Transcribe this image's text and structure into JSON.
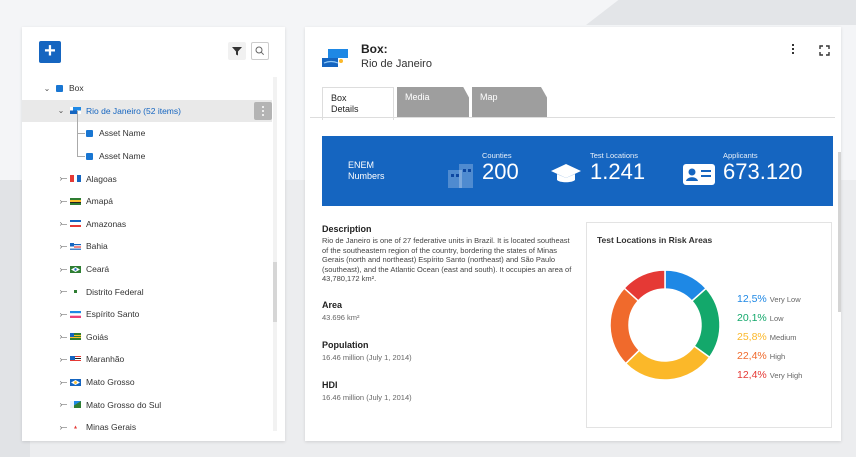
{
  "colors": {
    "accent": "#1565c0",
    "very_low": "#1e88e5",
    "low": "#13a86b",
    "medium": "#fbb829",
    "high": "#f06a2c",
    "very_high": "#e53935"
  },
  "left": {
    "add_label": "+",
    "tree": [
      {
        "label": "Box",
        "level": 0,
        "caret": "⌄",
        "icon": "box-square"
      },
      {
        "label": "Rio de Janeiro (52 items)",
        "level": 1,
        "caret": "⌄",
        "icon": "rio-flag",
        "selected": true
      },
      {
        "label": "Asset Name",
        "level": 2,
        "caret": "",
        "icon": "box-square"
      },
      {
        "label": "Asset Name",
        "level": 2,
        "caret": "",
        "icon": "box-square"
      },
      {
        "label": "Alagoas",
        "level": 1,
        "caret": "›",
        "icon": "alagoas-flag"
      },
      {
        "label": "Amapá",
        "level": 1,
        "caret": "›",
        "icon": "amapa-flag"
      },
      {
        "label": "Amazonas",
        "level": 1,
        "caret": "›",
        "icon": "amazonas-flag"
      },
      {
        "label": "Bahia",
        "level": 1,
        "caret": "›",
        "icon": "bahia-flag"
      },
      {
        "label": "Ceará",
        "level": 1,
        "caret": "›",
        "icon": "ceara-flag"
      },
      {
        "label": "Distrito Federal",
        "level": 1,
        "caret": "›",
        "icon": "df-flag"
      },
      {
        "label": "Espírito Santo",
        "level": 1,
        "caret": "›",
        "icon": "es-flag"
      },
      {
        "label": "Goiás",
        "level": 1,
        "caret": "›",
        "icon": "goias-flag"
      },
      {
        "label": "Maranhão",
        "level": 1,
        "caret": "›",
        "icon": "maranhao-flag"
      },
      {
        "label": "Mato Grosso",
        "level": 1,
        "caret": "›",
        "icon": "mt-flag"
      },
      {
        "label": "Mato Grosso do Sul",
        "level": 1,
        "caret": "›",
        "icon": "ms-flag"
      },
      {
        "label": "Minas Gerais",
        "level": 1,
        "caret": "›",
        "icon": "mg-flag"
      }
    ]
  },
  "header": {
    "title": "Box:",
    "subtitle": "Rio de Janeiro"
  },
  "tabs": [
    {
      "label": "Box\nDetails",
      "active": true
    },
    {
      "label": "Media",
      "active": false
    },
    {
      "label": "Map",
      "active": false
    }
  ],
  "band": {
    "heading": "ENEM\nNumbers",
    "stats": [
      {
        "label": "Counties",
        "value": "200",
        "icon": "buildings-icon"
      },
      {
        "label": "Test Locations",
        "value": "1.241",
        "icon": "graduation-cap-icon"
      },
      {
        "label": "Applicants",
        "value": "673.120",
        "icon": "id-card-icon"
      }
    ]
  },
  "description": {
    "heading": "Description",
    "text": "Rio de Janeiro is one of 27 federative units in Brazil. It is located southeast of the southeastern region of the country, bordering the states of Minas Gerais (north and northeast) Espírito Santo (northeast) and São Paulo (southeast), and the Atlantic Ocean (east and south). It occupies an area of 43,780,172 km²."
  },
  "properties": [
    {
      "label": "Area",
      "value": "43.696 km²"
    },
    {
      "label": "Population",
      "value": "16.46 million (July 1, 2014)"
    },
    {
      "label": "HDI",
      "value": "16.46 million (July 1, 2014)"
    }
  ],
  "risk": {
    "title": "Test Locations in Risk Areas",
    "items": [
      {
        "pct": "12,5%",
        "label": "Very Low",
        "value": 12.5,
        "color": "#1e88e5"
      },
      {
        "pct": "20,1%",
        "label": "Low",
        "value": 20.1,
        "color": "#13a86b"
      },
      {
        "pct": "25,8%",
        "label": "Medium",
        "value": 25.8,
        "color": "#fbb829"
      },
      {
        "pct": "22,4%",
        "label": "High",
        "value": 22.4,
        "color": "#f06a2c"
      },
      {
        "pct": "12,4%",
        "label": "Very High",
        "value": 12.4,
        "color": "#e53935"
      }
    ]
  }
}
